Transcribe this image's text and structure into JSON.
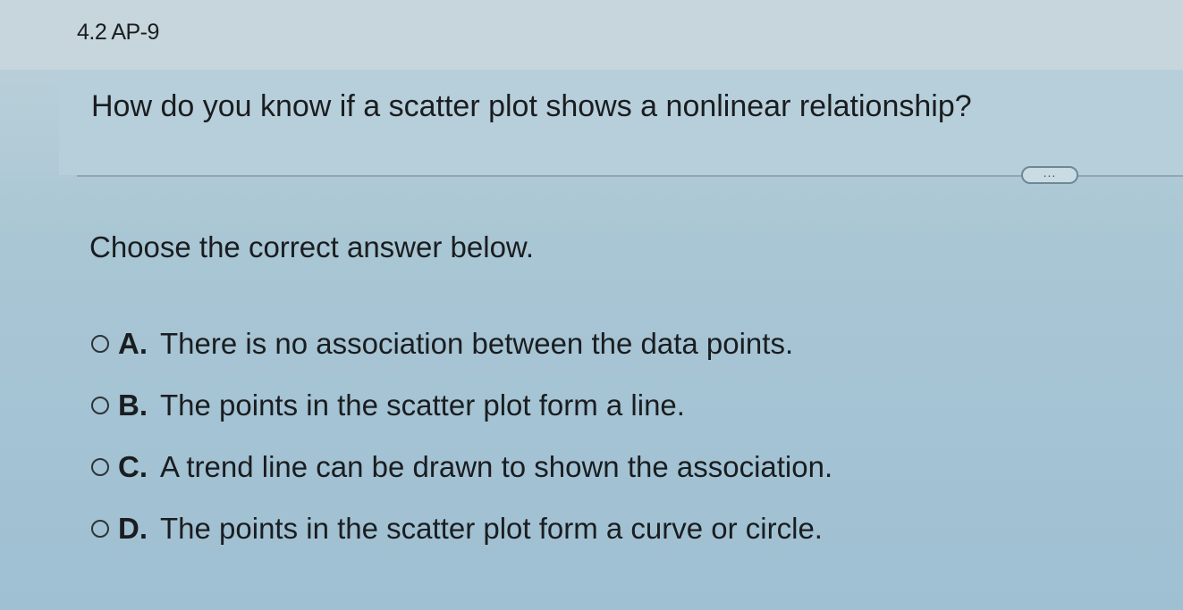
{
  "header": {
    "problem_id": "4.2 AP-9"
  },
  "question": {
    "text": "How do you know if a scatter plot shows a nonlinear relationship?"
  },
  "more_button": {
    "icon": "ellipsis-icon",
    "label": "..."
  },
  "prompt": "Choose the correct answer below.",
  "choices": [
    {
      "letter": "A.",
      "text": "There is no association between the data points."
    },
    {
      "letter": "B.",
      "text": "The points in the scatter plot form a line."
    },
    {
      "letter": "C.",
      "text": "A trend line can be drawn to shown the association."
    },
    {
      "letter": "D.",
      "text": "The points in the scatter plot form a curve or circle."
    }
  ]
}
